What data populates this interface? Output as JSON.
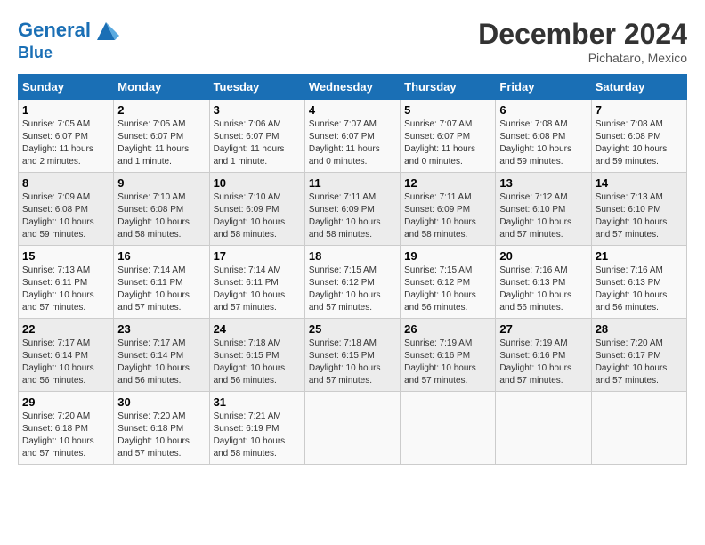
{
  "header": {
    "logo_line1": "General",
    "logo_line2": "Blue",
    "month": "December 2024",
    "location": "Pichataro, Mexico"
  },
  "weekdays": [
    "Sunday",
    "Monday",
    "Tuesday",
    "Wednesday",
    "Thursday",
    "Friday",
    "Saturday"
  ],
  "weeks": [
    [
      {
        "day": "1",
        "sunrise": "7:05 AM",
        "sunset": "6:07 PM",
        "daylight": "11 hours and 2 minutes."
      },
      {
        "day": "2",
        "sunrise": "7:05 AM",
        "sunset": "6:07 PM",
        "daylight": "11 hours and 1 minute."
      },
      {
        "day": "3",
        "sunrise": "7:06 AM",
        "sunset": "6:07 PM",
        "daylight": "11 hours and 1 minute."
      },
      {
        "day": "4",
        "sunrise": "7:07 AM",
        "sunset": "6:07 PM",
        "daylight": "11 hours and 0 minutes."
      },
      {
        "day": "5",
        "sunrise": "7:07 AM",
        "sunset": "6:07 PM",
        "daylight": "11 hours and 0 minutes."
      },
      {
        "day": "6",
        "sunrise": "7:08 AM",
        "sunset": "6:08 PM",
        "daylight": "10 hours and 59 minutes."
      },
      {
        "day": "7",
        "sunrise": "7:08 AM",
        "sunset": "6:08 PM",
        "daylight": "10 hours and 59 minutes."
      }
    ],
    [
      {
        "day": "8",
        "sunrise": "7:09 AM",
        "sunset": "6:08 PM",
        "daylight": "10 hours and 59 minutes."
      },
      {
        "day": "9",
        "sunrise": "7:10 AM",
        "sunset": "6:08 PM",
        "daylight": "10 hours and 58 minutes."
      },
      {
        "day": "10",
        "sunrise": "7:10 AM",
        "sunset": "6:09 PM",
        "daylight": "10 hours and 58 minutes."
      },
      {
        "day": "11",
        "sunrise": "7:11 AM",
        "sunset": "6:09 PM",
        "daylight": "10 hours and 58 minutes."
      },
      {
        "day": "12",
        "sunrise": "7:11 AM",
        "sunset": "6:09 PM",
        "daylight": "10 hours and 58 minutes."
      },
      {
        "day": "13",
        "sunrise": "7:12 AM",
        "sunset": "6:10 PM",
        "daylight": "10 hours and 57 minutes."
      },
      {
        "day": "14",
        "sunrise": "7:13 AM",
        "sunset": "6:10 PM",
        "daylight": "10 hours and 57 minutes."
      }
    ],
    [
      {
        "day": "15",
        "sunrise": "7:13 AM",
        "sunset": "6:11 PM",
        "daylight": "10 hours and 57 minutes."
      },
      {
        "day": "16",
        "sunrise": "7:14 AM",
        "sunset": "6:11 PM",
        "daylight": "10 hours and 57 minutes."
      },
      {
        "day": "17",
        "sunrise": "7:14 AM",
        "sunset": "6:11 PM",
        "daylight": "10 hours and 57 minutes."
      },
      {
        "day": "18",
        "sunrise": "7:15 AM",
        "sunset": "6:12 PM",
        "daylight": "10 hours and 57 minutes."
      },
      {
        "day": "19",
        "sunrise": "7:15 AM",
        "sunset": "6:12 PM",
        "daylight": "10 hours and 56 minutes."
      },
      {
        "day": "20",
        "sunrise": "7:16 AM",
        "sunset": "6:13 PM",
        "daylight": "10 hours and 56 minutes."
      },
      {
        "day": "21",
        "sunrise": "7:16 AM",
        "sunset": "6:13 PM",
        "daylight": "10 hours and 56 minutes."
      }
    ],
    [
      {
        "day": "22",
        "sunrise": "7:17 AM",
        "sunset": "6:14 PM",
        "daylight": "10 hours and 56 minutes."
      },
      {
        "day": "23",
        "sunrise": "7:17 AM",
        "sunset": "6:14 PM",
        "daylight": "10 hours and 56 minutes."
      },
      {
        "day": "24",
        "sunrise": "7:18 AM",
        "sunset": "6:15 PM",
        "daylight": "10 hours and 56 minutes."
      },
      {
        "day": "25",
        "sunrise": "7:18 AM",
        "sunset": "6:15 PM",
        "daylight": "10 hours and 57 minutes."
      },
      {
        "day": "26",
        "sunrise": "7:19 AM",
        "sunset": "6:16 PM",
        "daylight": "10 hours and 57 minutes."
      },
      {
        "day": "27",
        "sunrise": "7:19 AM",
        "sunset": "6:16 PM",
        "daylight": "10 hours and 57 minutes."
      },
      {
        "day": "28",
        "sunrise": "7:20 AM",
        "sunset": "6:17 PM",
        "daylight": "10 hours and 57 minutes."
      }
    ],
    [
      {
        "day": "29",
        "sunrise": "7:20 AM",
        "sunset": "6:18 PM",
        "daylight": "10 hours and 57 minutes."
      },
      {
        "day": "30",
        "sunrise": "7:20 AM",
        "sunset": "6:18 PM",
        "daylight": "10 hours and 57 minutes."
      },
      {
        "day": "31",
        "sunrise": "7:21 AM",
        "sunset": "6:19 PM",
        "daylight": "10 hours and 58 minutes."
      },
      null,
      null,
      null,
      null
    ]
  ]
}
